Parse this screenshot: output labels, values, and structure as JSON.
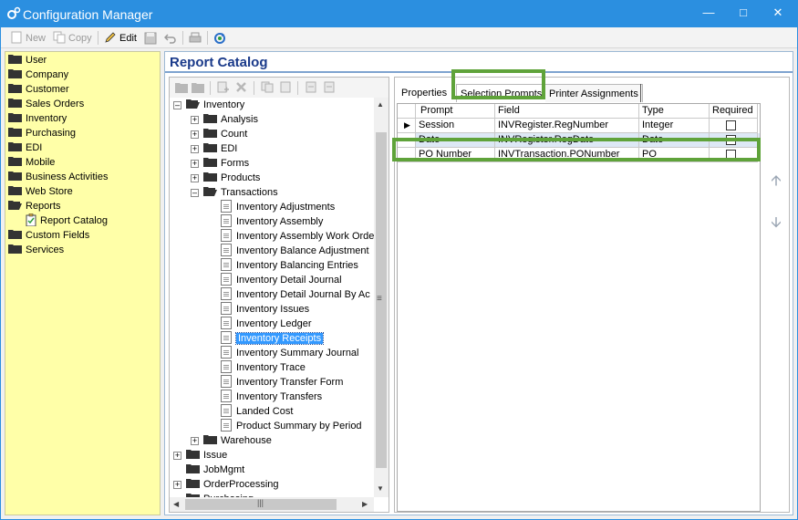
{
  "window": {
    "title": "Configuration Manager"
  },
  "toolbar": {
    "new_label": "New",
    "copy_label": "Copy",
    "edit_label": "Edit"
  },
  "nav": {
    "items": [
      "User",
      "Company",
      "Customer",
      "Sales Orders",
      "Inventory",
      "Purchasing",
      "EDI",
      "Mobile",
      "Business Activities",
      "Web Store",
      "Reports"
    ],
    "report_catalog": "Report Catalog",
    "after": [
      "Custom Fields",
      "Services"
    ]
  },
  "main": {
    "title": "Report Catalog"
  },
  "tree": {
    "root": "Inventory",
    "groups": [
      "Analysis",
      "Count",
      "EDI",
      "Forms",
      "Products",
      "Transactions"
    ],
    "transactions": [
      "Inventory Adjustments",
      "Inventory Assembly",
      "Inventory Assembly Work Orde",
      "Inventory Balance Adjustment",
      "Inventory Balancing Entries",
      "Inventory Detail Journal",
      "Inventory Detail Journal By Ac",
      "Inventory Issues",
      "Inventory Ledger",
      "Inventory Receipts",
      "Inventory Summary Journal",
      "Inventory Trace",
      "Inventory Transfer Form",
      "Inventory Transfers",
      "Landed Cost",
      "Product Summary by Period"
    ],
    "warehouse": "Warehouse",
    "other_roots": [
      "Issue",
      "JobMgmt",
      "OrderProcessing",
      "Purchasing"
    ]
  },
  "tabs": [
    "Properties",
    "Selection Prompts",
    "Printer Assignments"
  ],
  "grid": {
    "headers": [
      "Prompt",
      "Field",
      "Type",
      "Required"
    ],
    "rows": [
      {
        "prompt": "Session",
        "field": "INVRegister.RegNumber",
        "type": "Integer"
      },
      {
        "prompt": "Date",
        "field": "INVRegister.RegDate",
        "type": "Date"
      },
      {
        "prompt": "PO Number",
        "field": "INVTransaction.PONumber",
        "type": "PO"
      }
    ]
  }
}
